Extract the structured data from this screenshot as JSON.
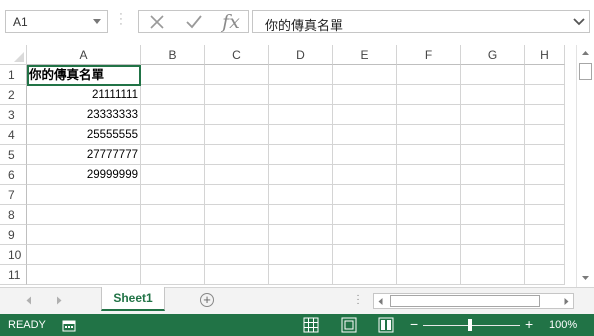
{
  "formula_bar": {
    "name_box": "A1",
    "fx_label": "fx",
    "formula": "你的傳真名單"
  },
  "columns": [
    "A",
    "B",
    "C",
    "D",
    "E",
    "F",
    "G",
    "H"
  ],
  "rows": [
    "1",
    "2",
    "3",
    "4",
    "5",
    "6",
    "7",
    "8",
    "9",
    "10",
    "11"
  ],
  "cells": {
    "A1": "你的傳真名單",
    "A2": "21111111",
    "A3": "23333333",
    "A4": "25555555",
    "A5": "27777777",
    "A6": "29999999"
  },
  "sheet_tabs": {
    "active": "Sheet1",
    "add_label": "+"
  },
  "status_bar": {
    "ready": "READY",
    "zoom": "100%"
  },
  "colors": {
    "accent": "#217346",
    "gridline": "#d4d4d4"
  },
  "icons": [
    "cancel-icon",
    "enter-check-icon",
    "fx-icon",
    "expand-chevron-icon",
    "add-sheet-icon",
    "normal-view-icon",
    "page-layout-icon",
    "page-break-icon",
    "macro-record-icon"
  ]
}
